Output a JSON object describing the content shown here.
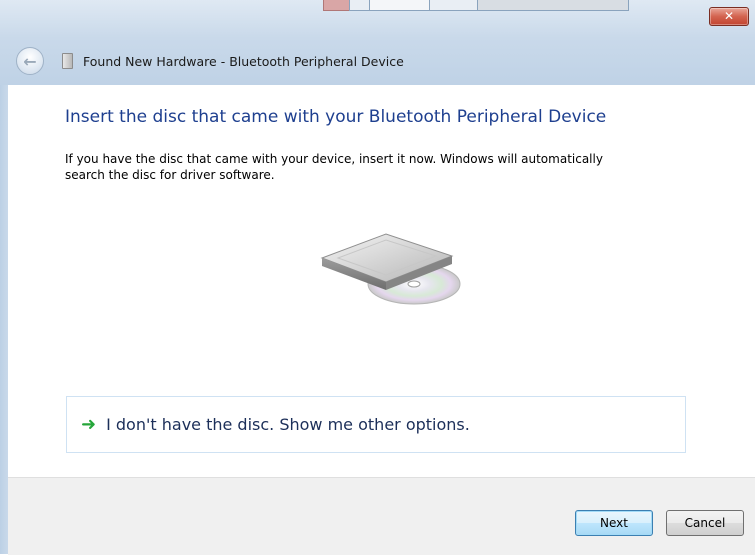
{
  "window": {
    "close_label": "✕",
    "title": "Found New Hardware - Bluetooth Peripheral Device"
  },
  "content": {
    "heading": "Insert the disc that came with your Bluetooth Peripheral Device",
    "body_line1": "If you have the disc that came with your device, insert it now.  Windows will automatically",
    "body_line2": "search the disc for driver software.",
    "option_text": "I don't have the disc.  Show me other options."
  },
  "buttons": {
    "next": "Next",
    "cancel": "Cancel"
  },
  "colors": {
    "heading": "#1e3f8f",
    "option_arrow": "#26a63a",
    "close_button": "#c24430"
  },
  "icons": {
    "back": "back-arrow-icon",
    "device": "device-icon",
    "disc": "disc-drive-icon",
    "option": "green-arrow-icon"
  }
}
